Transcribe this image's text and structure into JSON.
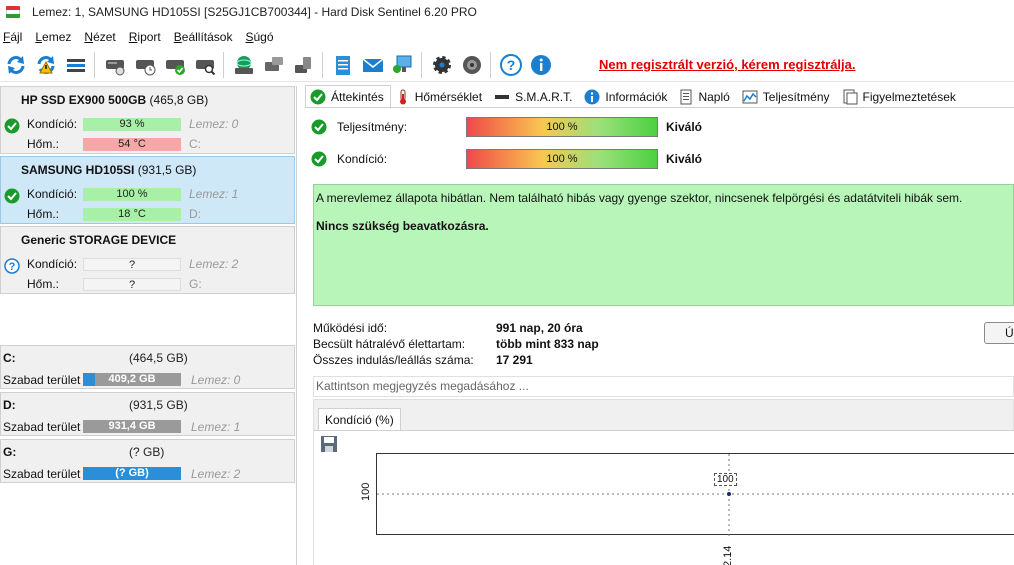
{
  "window": {
    "title": "Lemez: 1, SAMSUNG HD105SI [S25GJ1CB700344] - Hard Disk Sentinel 6.20 PRO"
  },
  "menu": {
    "items": [
      {
        "first": "F",
        "rest": "ájl"
      },
      {
        "first": "L",
        "rest": "emez"
      },
      {
        "first": "N",
        "rest": "ézet"
      },
      {
        "first": "R",
        "rest": "iport"
      },
      {
        "first": "B",
        "rest": "eállítások"
      },
      {
        "first": "S",
        "rest": "úgó"
      }
    ]
  },
  "toolbar": {
    "icons": [
      "refresh-icon",
      "refresh-warning-icon",
      "disk-bar-icon",
      "disk-test-icon",
      "disk-schedule-icon",
      "disk-ok-icon",
      "disk-search-icon",
      "network-disk-icon",
      "disk-tools-icon",
      "disk-copy-icon",
      "notepad-icon",
      "mail-icon",
      "network-icon",
      "settings-gear-icon",
      "speaker-icon",
      "help-icon",
      "info-icon"
    ],
    "register_text": "Nem regisztrált verzió, kérem regisztrálja.",
    "colors": {
      "register": "#e00000"
    }
  },
  "disks": [
    {
      "name": "HP SSD EX900 500GB",
      "size": "(465,8 GB)",
      "status": "ok",
      "condition_label": "Kondíció:",
      "condition": "93 %",
      "condition_fraction": 0.93,
      "temp_label": "Hőm.:",
      "temp": "54 °C",
      "temp_state": "hot",
      "disk_ref": "Lemez: 0",
      "drive": "C:"
    },
    {
      "name": "SAMSUNG HD105SI",
      "size": "(931,5 GB)",
      "status": "ok",
      "condition_label": "Kondíció:",
      "condition": "100 %",
      "condition_fraction": 1.0,
      "temp_label": "Hőm.:",
      "temp": "18 °C",
      "temp_state": "ok",
      "disk_ref": "Lemez: 1",
      "drive": "D:"
    },
    {
      "name": "Generic STORAGE DEVICE",
      "size": "",
      "status": "unknown",
      "condition_label": "Kondíció:",
      "condition": "?",
      "condition_fraction": 0,
      "temp_label": "Hőm.:",
      "temp": "?",
      "temp_state": "unknown",
      "disk_ref": "Lemez: 2",
      "drive": "G:"
    }
  ],
  "volumes": [
    {
      "letter": "C:",
      "size": "(464,5 GB)",
      "free_label": "Szabad terület",
      "free": "409,2 GB",
      "used_fraction": 0.12,
      "disk_ref": "Lemez: 0"
    },
    {
      "letter": "D:",
      "size": "(931,5 GB)",
      "free_label": "Szabad terület",
      "free": "931,4 GB",
      "used_fraction": 0.0,
      "disk_ref": "Lemez: 1"
    },
    {
      "letter": "G:",
      "size": "(? GB)",
      "free_label": "Szabad terület",
      "free": "(? GB)",
      "used_fraction": 1.0,
      "disk_ref": "Lemez: 2"
    }
  ],
  "tabs": [
    {
      "label": "Áttekintés",
      "icon": "check-icon",
      "active": true
    },
    {
      "label": "Hőmérséklet",
      "icon": "thermometer-icon",
      "active": false
    },
    {
      "label": "S.M.A.R.T.",
      "icon": "smart-bar-icon",
      "active": false
    },
    {
      "label": "Információk",
      "icon": "info-icon",
      "active": false
    },
    {
      "label": "Napló",
      "icon": "log-icon",
      "active": false
    },
    {
      "label": "Teljesítmény",
      "icon": "performance-icon",
      "active": false
    },
    {
      "label": "Figyelmeztetések",
      "icon": "alerts-icon",
      "active": false
    }
  ],
  "overview": {
    "performance_label": "Teljesítmény:",
    "performance": "100 %",
    "performance_rating": "Kiváló",
    "condition_label": "Kondíció:",
    "condition": "100 %",
    "condition_rating": "Kiváló",
    "summary_line1": "A merevlemez állapota hibátlan. Nem található hibás vagy gyenge szektor, nincsenek felpörgési és adatátviteli hibák sem.",
    "summary_line2": "Nincs szükség beavatkozásra.",
    "uptime_label": "Működési idő:",
    "uptime": "991 nap, 20 óra",
    "remaining_label": "Becsült hátralévő élettartam:",
    "remaining": "több mint 833 nap",
    "starts_label": "Összes indulás/leállás száma:",
    "starts": "17 291",
    "side_button": "Ú",
    "note_placeholder": "Kattintson megjegyzés megadásához ..."
  },
  "chart_tab": "Kondíció  (%)",
  "chart_data": {
    "type": "line",
    "x": [
      "2.14"
    ],
    "series": [
      {
        "values": [
          100
        ]
      }
    ],
    "y_tick": "100",
    "point_label": "100",
    "grid": "dashed-crosshair"
  }
}
